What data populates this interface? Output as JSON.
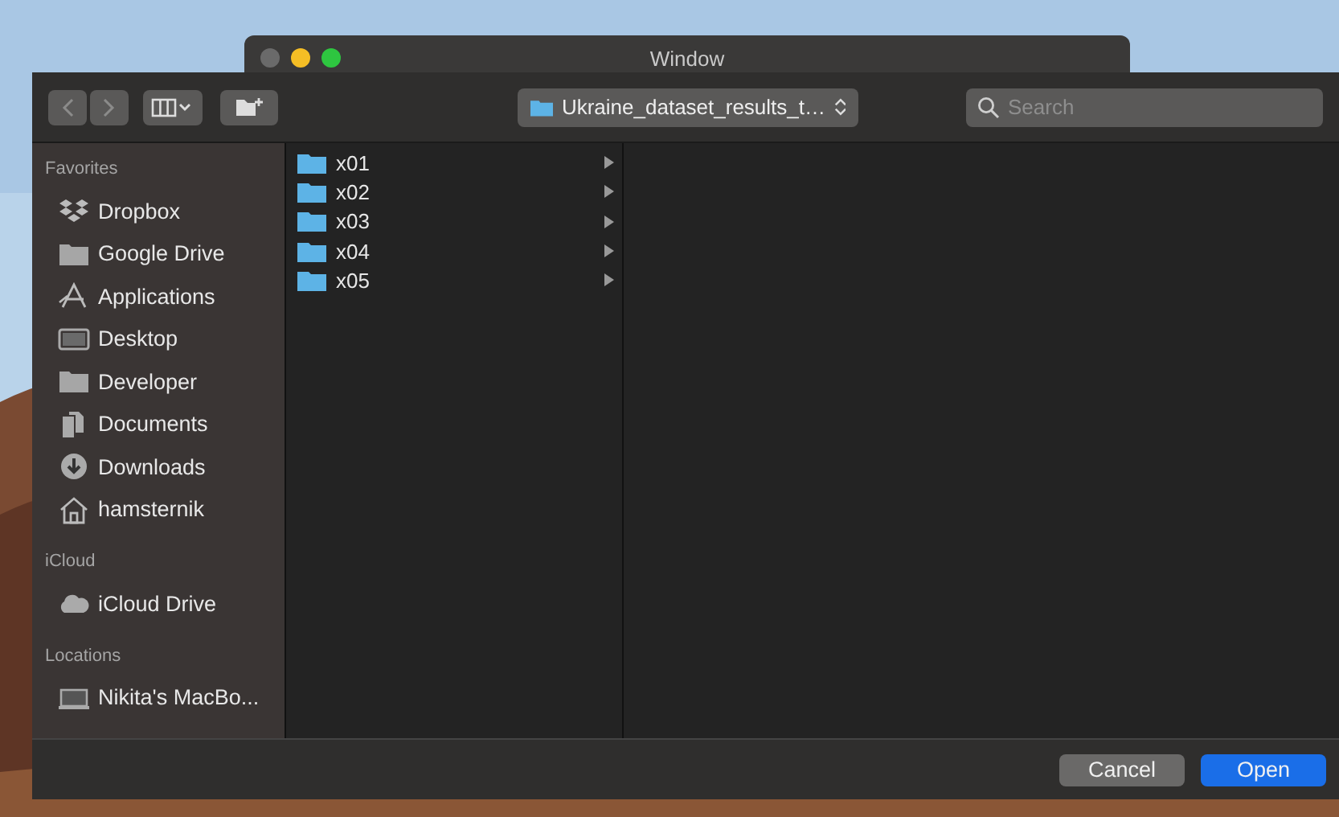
{
  "back_window": {
    "title": "Window"
  },
  "toolbar": {
    "nav": [
      {
        "disabled": true
      },
      {
        "disabled": true
      }
    ],
    "path": "Ukraine_dataset_results_t…",
    "search": {
      "placeholder": "Search"
    }
  },
  "sidebar": [
    {
      "heading": "Favorites",
      "items": [
        {
          "label": "Dropbox",
          "kind": "dropbox"
        },
        {
          "label": "Google Drive",
          "kind": "folder"
        },
        {
          "label": "Applications",
          "kind": "applications"
        },
        {
          "label": "Desktop",
          "kind": "desktop"
        },
        {
          "label": "Developer",
          "kind": "folder"
        },
        {
          "label": "Documents",
          "kind": "documents"
        },
        {
          "label": "Downloads",
          "kind": "downloads"
        },
        {
          "label": "hamsternik",
          "kind": "home"
        }
      ]
    },
    {
      "heading": "iCloud",
      "items": [
        {
          "label": "iCloud Drive",
          "kind": "cloud"
        }
      ]
    },
    {
      "heading": "Locations",
      "items": [
        {
          "label": "Nikita's MacBo...",
          "kind": "laptop"
        }
      ]
    }
  ],
  "folders": [
    {
      "name": "x01",
      "selected": false
    },
    {
      "name": "x02",
      "selected": false
    },
    {
      "name": "x03",
      "selected": false
    },
    {
      "name": "x04",
      "selected": false
    },
    {
      "name": "x05",
      "selected": false
    }
  ],
  "buttons": [
    {
      "label": "Cancel",
      "kind": "secondary"
    },
    {
      "label": "Open",
      "kind": "primary"
    }
  ]
}
